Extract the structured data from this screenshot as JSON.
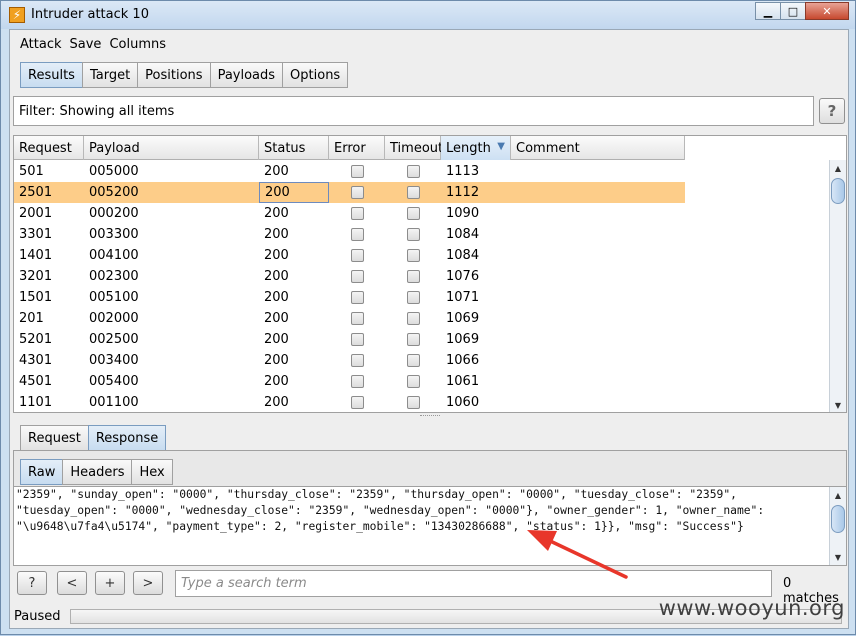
{
  "window": {
    "title": "Intruder attack 10",
    "icon": "burp-icon",
    "controls": [
      "minimize-icon",
      "maximize-icon",
      "close-icon"
    ]
  },
  "menu": [
    "Attack",
    "Save",
    "Columns"
  ],
  "main_tabs": [
    {
      "label": "Results",
      "active": true
    },
    {
      "label": "Target",
      "active": false
    },
    {
      "label": "Positions",
      "active": false
    },
    {
      "label": "Payloads",
      "active": false
    },
    {
      "label": "Options",
      "active": false
    }
  ],
  "filter": {
    "text": "Filter: Showing all items",
    "help": "?"
  },
  "table": {
    "columns": [
      "Request",
      "Payload",
      "Status",
      "Error",
      "Timeout",
      "Length",
      "Comment"
    ],
    "sorted_column": "Length",
    "rows": [
      {
        "request": "501",
        "payload": "005000",
        "status": "200",
        "length": "1113"
      },
      {
        "request": "2501",
        "payload": "005200",
        "status": "200",
        "length": "1112",
        "selected": true
      },
      {
        "request": "2001",
        "payload": "000200",
        "status": "200",
        "length": "1090"
      },
      {
        "request": "3301",
        "payload": "003300",
        "status": "200",
        "length": "1084"
      },
      {
        "request": "1401",
        "payload": "004100",
        "status": "200",
        "length": "1084"
      },
      {
        "request": "3201",
        "payload": "002300",
        "status": "200",
        "length": "1076"
      },
      {
        "request": "1501",
        "payload": "005100",
        "status": "200",
        "length": "1071"
      },
      {
        "request": "201",
        "payload": "002000",
        "status": "200",
        "length": "1069"
      },
      {
        "request": "5201",
        "payload": "002500",
        "status": "200",
        "length": "1069"
      },
      {
        "request": "4301",
        "payload": "003400",
        "status": "200",
        "length": "1066"
      },
      {
        "request": "4501",
        "payload": "005400",
        "status": "200",
        "length": "1061"
      },
      {
        "request": "1101",
        "payload": "001100",
        "status": "200",
        "length": "1060"
      }
    ]
  },
  "req_resp_tabs": [
    {
      "label": "Request",
      "active": false
    },
    {
      "label": "Response",
      "active": true
    }
  ],
  "view_tabs": [
    {
      "label": "Raw",
      "active": true
    },
    {
      "label": "Headers",
      "active": false
    },
    {
      "label": "Hex",
      "active": false
    }
  ],
  "response_lines": [
    "\"2359\", \"sunday_open\": \"0000\", \"thursday_close\": \"2359\", \"thursday_open\": \"0000\", \"tuesday_close\": \"2359\",",
    "\"tuesday_open\": \"0000\", \"wednesday_close\": \"2359\", \"wednesday_open\": \"0000\"}, \"owner_gender\": 1, \"owner_name\":",
    "\"\\u9648\\u7fa4\\u5174\", \"payment_type\": 2, \"register_mobile\": \"13430286688\", \"status\": 1}}, \"msg\": \"Success\"}"
  ],
  "search": {
    "help": "?",
    "prev": "<",
    "add": "+",
    "next": ">",
    "placeholder": "Type a search term",
    "matches": "0 matches"
  },
  "status": {
    "text": "Paused"
  },
  "watermark": "www.wooyun.org",
  "colors": {
    "selected_row": "#fdcd89",
    "annotation_arrow": "#e8362a",
    "active_tab": "#c7dcf0"
  }
}
